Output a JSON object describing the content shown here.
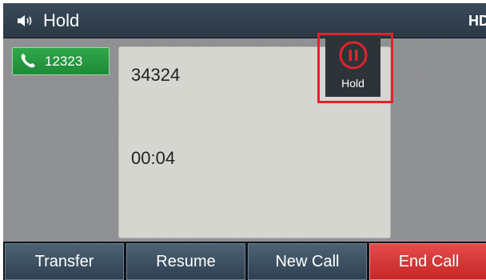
{
  "status_bar": {
    "title": "Hold",
    "badge": "HD",
    "icon": "speaker-icon"
  },
  "line_key": {
    "label": "12323",
    "icon": "phone-icon",
    "color": "#2ea84a"
  },
  "call": {
    "number": "34324",
    "duration": "00:04"
  },
  "hold_button": {
    "label": "Hold",
    "icon": "pause-icon",
    "highlight_color": "#e0242a"
  },
  "softkeys": [
    {
      "label": "Transfer"
    },
    {
      "label": "Resume"
    },
    {
      "label": "New Call"
    },
    {
      "label": "End Call",
      "color": "#e64b4b"
    }
  ]
}
